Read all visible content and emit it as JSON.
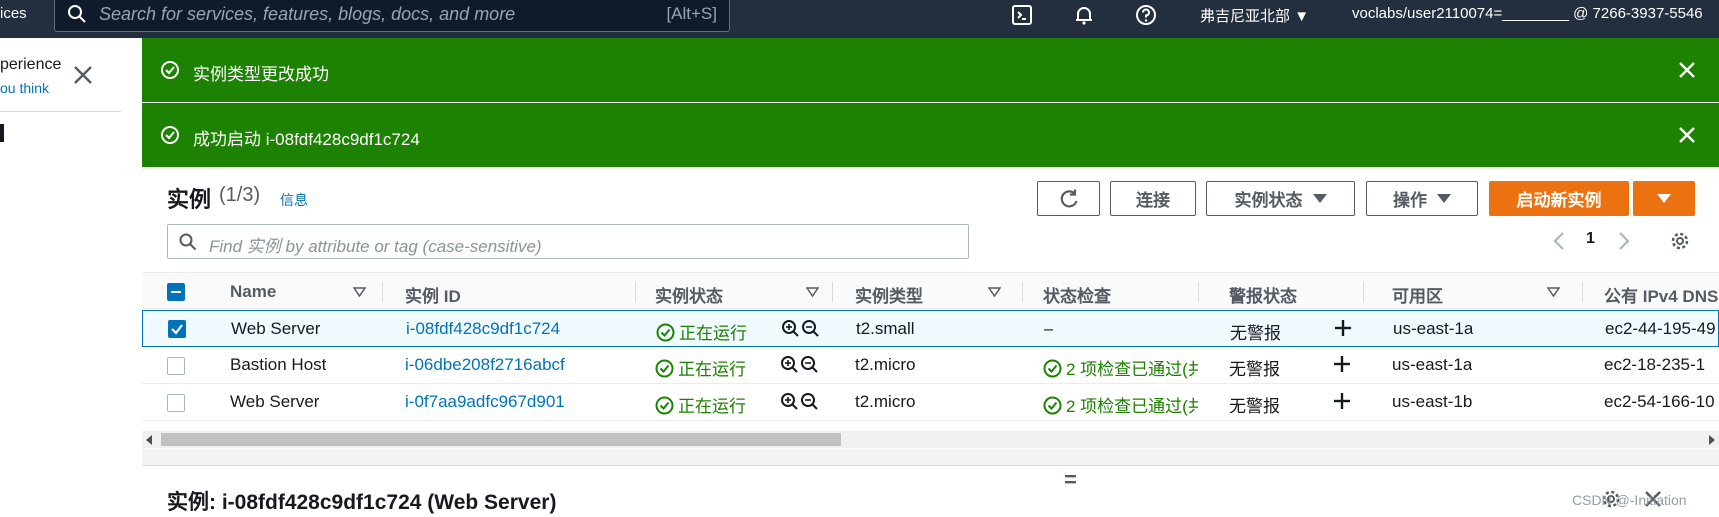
{
  "topnav": {
    "services_fragment": "ices",
    "search_placeholder": "Search for services, features, blogs, docs, and more",
    "search_shortcut": "[Alt+S]",
    "region": "弗吉尼亚北部",
    "account": "voclabs/user2110074=________ @ 7266-3937-5546"
  },
  "leftpanel": {
    "line1": "perience",
    "line2": "ou think"
  },
  "flash": [
    {
      "message": "实例类型更改成功"
    },
    {
      "message": "成功启动 i-08fdf428c9df1c724"
    }
  ],
  "instances": {
    "title": "实例",
    "count": "(1/3)",
    "info_link": "信息",
    "buttons": {
      "connect": "连接",
      "instance_state": "实例状态",
      "actions": "操作",
      "launch": "启动新实例"
    },
    "filter_placeholder": "Find 实例 by attribute or tag (case-sensitive)",
    "page": "1",
    "columns": [
      "Name",
      "实例 ID",
      "实例状态",
      "实例类型",
      "状态检查",
      "警报状态",
      "可用区",
      "公有 IPv4 DNS"
    ],
    "rows": [
      {
        "selected": true,
        "name": "Web Server",
        "id": "i-08fdf428c9df1c724",
        "state": "正在运行",
        "type": "t2.small",
        "check": "–",
        "alarm": "无警报",
        "az": "us-east-1a",
        "dns": "ec2-44-195-49"
      },
      {
        "selected": false,
        "name": "Bastion Host",
        "id": "i-06dbe208f2716abcf",
        "state": "正在运行",
        "type": "t2.micro",
        "check": "2 项检查已通过(共",
        "alarm": "无警报",
        "az": "us-east-1a",
        "dns": "ec2-18-235-1"
      },
      {
        "selected": false,
        "name": "Web Server",
        "id": "i-0f7aa9adfc967d901",
        "state": "正在运行",
        "type": "t2.micro",
        "check": "2 项检查已通过(共",
        "alarm": "无警报",
        "az": "us-east-1b",
        "dns": "ec2-54-166-10"
      }
    ]
  },
  "detail": {
    "handle": "=",
    "title": "实例: i-08fdf428c9df1c724 (Web Server)"
  },
  "watermark": "CSDN @-Initiation",
  "colors": {
    "nav": "#232f3e",
    "success": "#1d8102",
    "link": "#0073bb",
    "primary": "#ec7211"
  }
}
